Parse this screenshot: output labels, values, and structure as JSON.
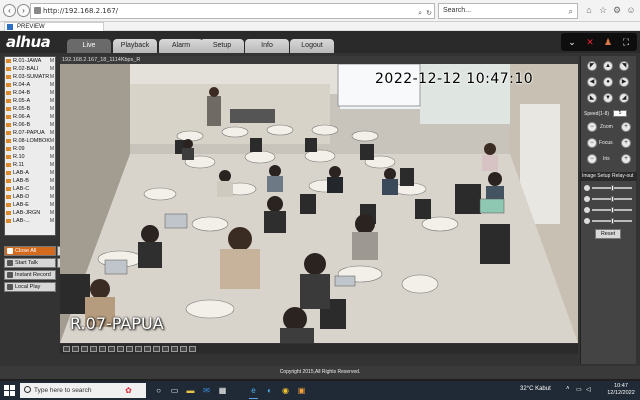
{
  "browser": {
    "url": "http://192.168.2.167/",
    "search_placeholder": "Search...",
    "tab_title": "PREVIEW"
  },
  "app": {
    "logo": "alhua",
    "nav_tabs": [
      "Live",
      "Playback",
      "Alarm",
      "Setup",
      "Info",
      "Logout"
    ],
    "active_tab": "Live"
  },
  "channels": [
    {
      "label": "R.01-JAWA",
      "flag": "M"
    },
    {
      "label": "R.02-BALI",
      "flag": "M"
    },
    {
      "label": "R.03-SUMATR",
      "flag": "M"
    },
    {
      "label": "R.04-A",
      "flag": "M"
    },
    {
      "label": "R.04-B",
      "flag": "M"
    },
    {
      "label": "R.05-A",
      "flag": "M"
    },
    {
      "label": "R.05-B",
      "flag": "M"
    },
    {
      "label": "R.06-A",
      "flag": "M"
    },
    {
      "label": "R.06-B",
      "flag": "M"
    },
    {
      "label": "R.07-PAPUA",
      "flag": "M"
    },
    {
      "label": "R.08-LOMBOK",
      "flag": "M"
    },
    {
      "label": "R.09",
      "flag": "M"
    },
    {
      "label": "R.10",
      "flag": "M"
    },
    {
      "label": "R.11",
      "flag": "M"
    },
    {
      "label": "LAB-A",
      "flag": "M"
    },
    {
      "label": "LAB-B",
      "flag": "M"
    },
    {
      "label": "LAB-C",
      "flag": "M"
    },
    {
      "label": "LAB-D",
      "flag": "M"
    },
    {
      "label": "LAB-E",
      "flag": "M"
    },
    {
      "label": "LAB-JRGN",
      "flag": "M"
    },
    {
      "label": "LAB-...",
      "flag": "M"
    }
  ],
  "left_buttons": {
    "close_all": "Close All",
    "start_talk": "Start Talk",
    "instant_record": "Instant Record",
    "local_play": "Local Play"
  },
  "video": {
    "title_bar": "192.168.2.167_18_1114Kbps_R",
    "osd_timestamp": "2022-12-12  10:47:10",
    "osd_channel": "R.07-PAPUA"
  },
  "ptz": {
    "speed_label": "Speed(1-8)",
    "speed_value": "5",
    "zoom_label": "Zoom",
    "focus_label": "Focus",
    "iris_label": "Iris",
    "image_setup": "Image Setup",
    "relay_out": "Relay-out",
    "reset": "Reset",
    "sliders": [
      0.5,
      0.5,
      0.5,
      0.5
    ]
  },
  "footer": {
    "copyright": "Copyright 2015,All Rights Reserved."
  },
  "taskbar": {
    "search_placeholder": "Type here to search",
    "weather": "32°C  Kabut",
    "time": "10:47",
    "date": "12/12/2022"
  }
}
